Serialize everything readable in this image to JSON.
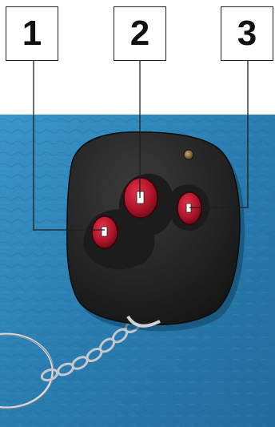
{
  "labels": [
    {
      "text": "1"
    },
    {
      "text": "2"
    },
    {
      "text": "3"
    }
  ],
  "colors": {
    "background": "#ffffff",
    "leather_blue": "#2f85b8",
    "fob_black": "#262626",
    "button_red": "#b1152a",
    "callout_line": "#1f1f1f"
  }
}
